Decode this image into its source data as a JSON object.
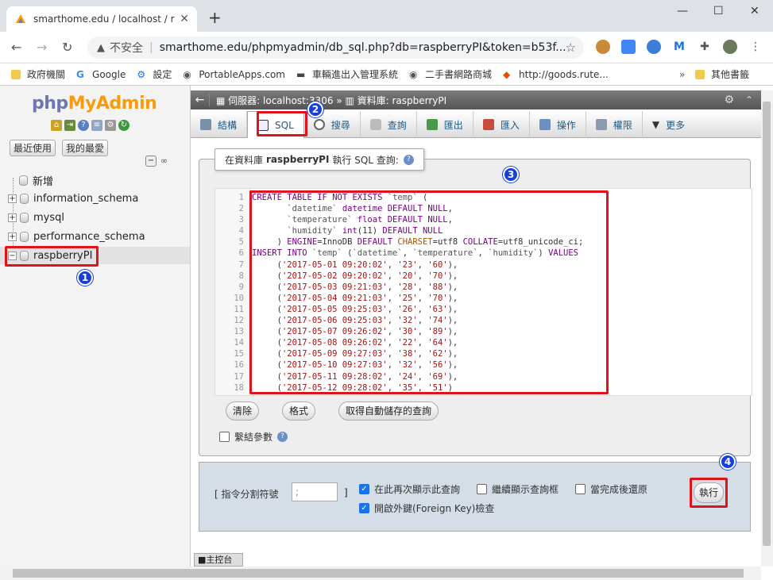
{
  "browser": {
    "tab_title": "smarthome.edu / localhost / ra",
    "not_secure": "不安全",
    "url": "smarthome.edu/phpmyadmin/db_sql.php?db=raspberryPI&token=b53f...",
    "bookmarks": [
      {
        "label": "政府機關",
        "icon": "folder-icon"
      },
      {
        "label": "Google",
        "icon": "google-icon"
      },
      {
        "label": "設定",
        "icon": "gear-icon"
      },
      {
        "label": "PortableApps.com",
        "icon": "globe-icon"
      },
      {
        "label": "車輛進出入管理系統",
        "icon": "car-icon"
      },
      {
        "label": "二手書網路商城",
        "icon": "globe-icon"
      },
      {
        "label": "http://goods.rute...",
        "icon": "link-icon"
      }
    ],
    "other_bookmarks": "其他書籤"
  },
  "sidebar": {
    "logo_php": "php",
    "logo_myadmin": "MyAdmin",
    "recent": "最近使用",
    "favorites": "我的最愛",
    "new": "新增",
    "databases": [
      "information_schema",
      "mysql",
      "performance_schema",
      "raspberryPI"
    ],
    "selected_db": "raspberryPI"
  },
  "breadcrumb": {
    "server": "伺服器: localhost:3306",
    "sep": "»",
    "database": "資料庫: raspberryPI"
  },
  "tabs": [
    {
      "label": "結構",
      "icon": "structure-icon"
    },
    {
      "label": "SQL",
      "icon": "sql-icon"
    },
    {
      "label": "搜尋",
      "icon": "search-icon"
    },
    {
      "label": "查詢",
      "icon": "query-icon"
    },
    {
      "label": "匯出",
      "icon": "export-icon"
    },
    {
      "label": "匯入",
      "icon": "import-icon"
    },
    {
      "label": "操作",
      "icon": "wrench-icon"
    },
    {
      "label": "權限",
      "icon": "privileges-icon"
    },
    {
      "label": "更多",
      "icon": "chevron-down-icon"
    }
  ],
  "active_tab": "SQL",
  "sql_panel": {
    "legend_prefix": "在資料庫",
    "legend_db": "raspberryPI",
    "legend_suffix": "執行 SQL 查詢:",
    "lines": [
      "CREATE TABLE IF NOT EXISTS `temp` (",
      "       `datetime` datetime DEFAULT NULL,",
      "       `temperature` float DEFAULT NULL,",
      "       `humidity` int(11) DEFAULT NULL",
      "     ) ENGINE=InnoDB DEFAULT CHARSET=utf8 COLLATE=utf8_unicode_ci;",
      "INSERT INTO `temp` (`datetime`, `temperature`, `humidity`) VALUES",
      "     ('2017-05-01 09:20:02', '23', '60'),",
      "     ('2017-05-02 09:20:02', '20', '70'),",
      "     ('2017-05-03 09:21:03', '28', '88'),",
      "     ('2017-05-04 09:21:03', '25', '70'),",
      "     ('2017-05-05 09:25:03', '26', '63'),",
      "     ('2017-05-06 09:25:03', '32', '74'),",
      "     ('2017-05-07 09:26:02', '30', '89'),",
      "     ('2017-05-08 09:26:02', '22', '64'),",
      "     ('2017-05-09 09:27:03', '38', '62'),",
      "     ('2017-05-10 09:27:03', '32', '56'),",
      "     ('2017-05-11 09:28:02', '24', '69'),",
      "     ('2017-05-12 09:28:02', '35', '51')"
    ],
    "clear_btn": "清除",
    "format_btn": "格式",
    "autosave_btn": "取得自動儲存的查詢",
    "bind_params": "繫結參數"
  },
  "options": {
    "delimiter_label": "[ 指令分割符號",
    "delimiter_value": ";",
    "delimiter_end": "]",
    "show_query_again": "在此再次顯示此查詢",
    "keep_query_box": "繼續顯示查詢框",
    "rollback": "當完成後還原",
    "fk_checks": "開啟外鍵(Foreign Key)檢查",
    "go_btn": "執行"
  },
  "console": "主控台",
  "annotations": [
    "1",
    "2",
    "3",
    "4"
  ]
}
